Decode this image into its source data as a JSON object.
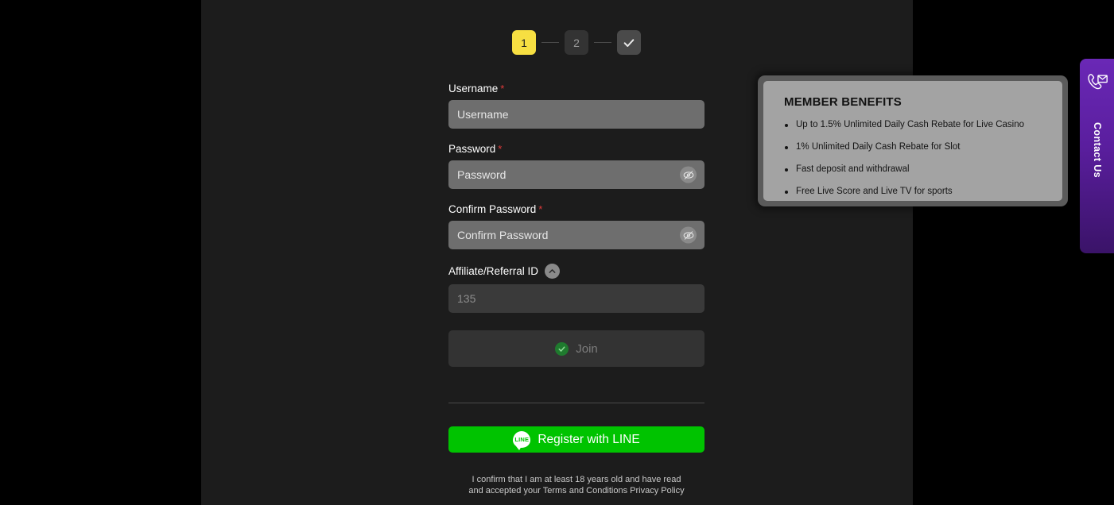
{
  "stepper": {
    "steps": [
      {
        "label": "1",
        "state": "active"
      },
      {
        "label": "2",
        "state": "idle"
      },
      {
        "label": "check-icon",
        "state": "done"
      }
    ]
  },
  "form": {
    "username": {
      "label": "Username",
      "required_mark": "*",
      "placeholder": "Username",
      "value": ""
    },
    "password": {
      "label": "Password",
      "required_mark": "*",
      "placeholder": "Password",
      "value": "",
      "toggle_icon": "eye-off-icon"
    },
    "confirm_password": {
      "label": "Confirm Password",
      "required_mark": "*",
      "placeholder": "Confirm Password",
      "value": "",
      "toggle_icon": "eye-off-icon"
    },
    "affiliate": {
      "label": "Affiliate/Referral ID",
      "toggle_icon": "chevron-up-icon",
      "placeholder": "135",
      "value": ""
    },
    "join_button": {
      "label": "Join",
      "icon": "green-check-icon",
      "disabled": true
    },
    "line_button": {
      "label": "Register with LINE",
      "icon_text": "LINE",
      "color": "#00c300"
    },
    "legal_line1": "I confirm that I am at least 18 years old and have read",
    "legal_line2": "and accepted your Terms and Conditions Privacy Policy"
  },
  "benefits": {
    "title": "MEMBER BENEFITS",
    "items": [
      "Up to 1.5% Unlimited Daily Cash Rebate for Live Casino",
      "1% Unlimited Daily Cash Rebate for Slot",
      "Fast deposit and withdrawal",
      "Free Live Score and Live TV for sports"
    ]
  },
  "contact": {
    "label": "Contact Us",
    "icon": "phone-envelope-icon",
    "color": "#5A1E9E"
  },
  "colors": {
    "page_background": "#000000",
    "content_background": "#1c1c1c",
    "accent_yellow": "#f7df42",
    "required_red": "#e03a3a",
    "input_light": "#6e6e6e",
    "input_dark": "#3a3a3a",
    "panel_gray": "#a3a3a3"
  }
}
